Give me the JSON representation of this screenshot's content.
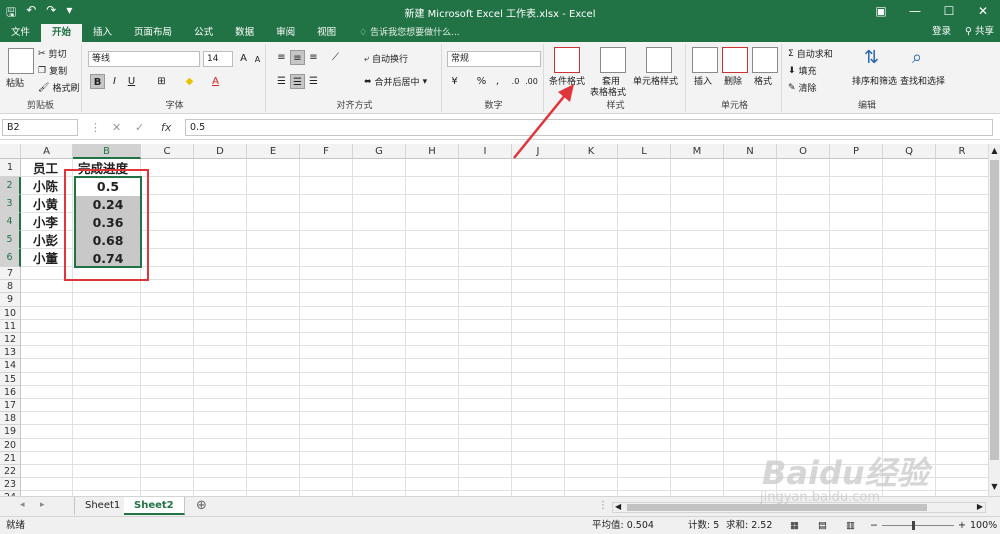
{
  "window": {
    "title": "新建 Microsoft Excel 工作表.xlsx - Excel"
  },
  "menu": {
    "tabs": [
      "文件",
      "开始",
      "插入",
      "页面布局",
      "公式",
      "数据",
      "审阅",
      "视图"
    ],
    "active_tab": "开始",
    "search_placeholder": "告诉我您想要做什么...",
    "login": "登录",
    "share": "共享"
  },
  "ribbon": {
    "clipboard": {
      "label": "剪贴板",
      "paste": "粘贴",
      "cut": "剪切",
      "copy": "复制",
      "format_painter": "格式刷"
    },
    "font": {
      "label": "字体",
      "name": "等线",
      "size": "14",
      "grow": "A",
      "shrink": "A",
      "bold": "B",
      "italic": "I",
      "underline": "U"
    },
    "alignment": {
      "label": "对齐方式",
      "wrap": "自动换行",
      "merge": "合并后居中"
    },
    "number": {
      "label": "数字",
      "format": "常规",
      "percent": "%",
      "comma": ","
    },
    "styles": {
      "label": "样式",
      "conditional": "条件格式",
      "table": "套用",
      "table2": "表格格式",
      "cell_styles": "单元格样式"
    },
    "cells": {
      "label": "单元格",
      "insert": "插入",
      "delete": "删除",
      "format": "格式"
    },
    "editing": {
      "label": "编辑",
      "autosum": "自动求和",
      "fill": "填充",
      "clear": "清除",
      "sort": "排序和筛选",
      "find": "查找和选择"
    }
  },
  "formula_bar": {
    "name_box": "B2",
    "fx": "fx",
    "cancel": "✕",
    "enter": "✓",
    "value": "0.5"
  },
  "columns": [
    "A",
    "B",
    "C",
    "D",
    "E",
    "F",
    "G",
    "H",
    "I",
    "J",
    "K",
    "L",
    "M",
    "N",
    "O",
    "P",
    "Q",
    "R"
  ],
  "rows": [
    "1",
    "2",
    "3",
    "4",
    "5",
    "6",
    "7",
    "8",
    "9",
    "10",
    "11",
    "12",
    "13",
    "14",
    "15",
    "16",
    "17",
    "18",
    "19",
    "20",
    "21",
    "22",
    "23",
    "24"
  ],
  "cells": {
    "A1": "员工",
    "B1": "完成进度",
    "A2": "小陈",
    "B2": "0.5",
    "A3": "小黄",
    "B3": "0.24",
    "A4": "小李",
    "B4": "0.36",
    "A5": "小彭",
    "B5": "0.68",
    "A6": "小董",
    "B6": "0.74"
  },
  "sheets": [
    "Sheet1",
    "Sheet2"
  ],
  "active_sheet": "Sheet2",
  "status": {
    "ready": "就绪",
    "average": "平均值: 0.504",
    "count": "计数: 5",
    "sum": "求和: 2.52",
    "zoom": "100%"
  },
  "watermark": {
    "brand": "Baidu经验",
    "url": "jingyan.baidu.com"
  },
  "colors": {
    "excel_green": "#217346",
    "highlight_red": "#e0353b",
    "selected_fill": "#c8c8c8"
  }
}
